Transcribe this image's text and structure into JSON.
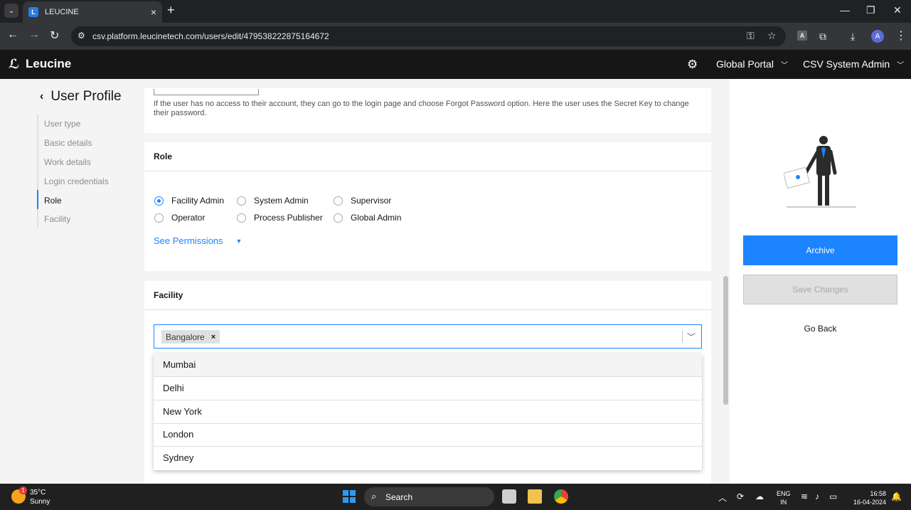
{
  "browser": {
    "tab_title": "LEUCINE",
    "url": "csv.platform.leucinetech.com/users/edit/479538222875164672"
  },
  "header": {
    "brand": "Leucine",
    "portal": "Global Portal",
    "user": "CSV System Admin"
  },
  "page": {
    "title": "User Profile",
    "steps": [
      "User type",
      "Basic details",
      "Work details",
      "Login credentials",
      "Role",
      "Facility"
    ],
    "active_step": "Role"
  },
  "credentials": {
    "help_text": "If the user has no access to their account, they can go to the login page and choose Forgot Password option. Here the user uses the Secret Key to change their password."
  },
  "role": {
    "heading": "Role",
    "options": [
      "Facility Admin",
      "System Admin",
      "Supervisor",
      "Operator",
      "Process Publisher",
      "Global Admin"
    ],
    "selected": "Facility Admin",
    "see_permissions": "See Permissions"
  },
  "facility": {
    "heading": "Facility",
    "selected_chip": "Bangalore",
    "options": [
      "Mumbai",
      "Delhi",
      "New York",
      "London",
      "Sydney"
    ]
  },
  "actions": {
    "archive": "Archive",
    "save": "Save Changes",
    "back": "Go Back"
  },
  "taskbar": {
    "temperature": "35°C",
    "condition": "Sunny",
    "weather_badge": "1",
    "search": "Search",
    "lang_top": "ENG",
    "lang_bottom": "IN",
    "time": "16:58",
    "date": "16-04-2024"
  },
  "colors": {
    "accent": "#1d84ff",
    "header_bg": "#161616"
  }
}
